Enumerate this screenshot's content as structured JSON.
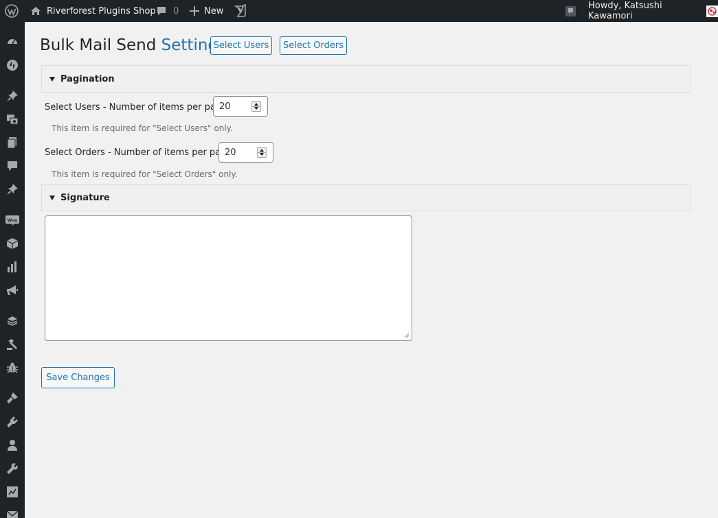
{
  "adminbar": {
    "wp_logo_icon": "wordpress-icon",
    "site_name": "Riverforest Plugins Shop",
    "comments_count": "0",
    "new_label": "New",
    "user_greeting": "Howdy, Katsushi Kawamori"
  },
  "sidebar": {
    "icons": [
      "dashboard-icon",
      "jetpack-icon",
      "pin-icon",
      "media-icon",
      "pages-icon",
      "comments-icon",
      "pin-icon",
      "woocommerce-icon",
      "products-icon",
      "analytics-icon",
      "marketing-icon",
      "stack-icon",
      "hammer-icon",
      "bug-icon",
      "appearance-icon",
      "plugins-icon",
      "users-icon",
      "tools-icon",
      "settings-icon",
      "mail-icon"
    ]
  },
  "page": {
    "title_main": "Bulk Mail Send",
    "title_accent": "Settings",
    "select_users_button": "Select Users",
    "select_orders_button": "Select Orders"
  },
  "pagination": {
    "heading": "Pagination",
    "users_label": "Select Users - Number of items per page:",
    "users_value": "20",
    "users_help": "This item is required for \"Select Users\" only.",
    "orders_label": "Select Orders - Number of items per page:",
    "orders_value": "20",
    "orders_help": "This item is required for \"Select Orders\" only."
  },
  "signature": {
    "heading": "Signature",
    "value": ""
  },
  "save_button": "Save Changes",
  "colors": {
    "accent": "#2271b1",
    "adminbar_bg": "#1d2327",
    "page_bg": "#f1f1f1"
  }
}
